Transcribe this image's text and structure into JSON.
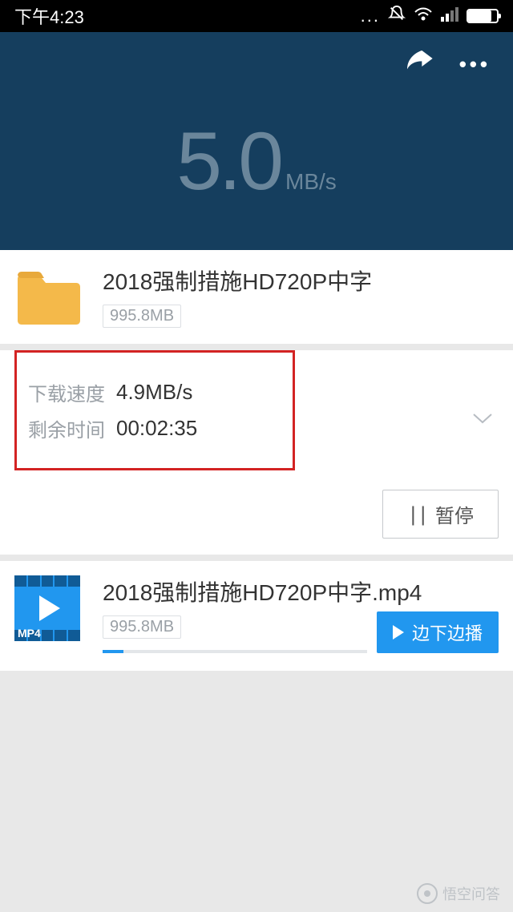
{
  "statusbar": {
    "time": "下午4:23",
    "dots": "...",
    "mute_icon": "bell-off",
    "wifi_icon": "wifi",
    "signal_icon": "signal",
    "battery_icon": "battery"
  },
  "hero": {
    "share_icon": "share",
    "more_icon": "more",
    "speed_value": "5.0",
    "speed_unit": "MB/s"
  },
  "folder": {
    "icon": "folder",
    "title": "2018强制措施HD720P中字",
    "size": "995.8MB"
  },
  "details": {
    "speed_label": "下载速度",
    "speed_value": "4.9MB/s",
    "time_label": "剩余时间",
    "time_value": "00:02:35",
    "chevron_icon": "chevron-down",
    "pause_label": "暂停"
  },
  "file": {
    "icon_type": "MP4",
    "title": "2018强制措施HD720P中字.mp4",
    "size": "995.8MB",
    "play_label": "边下边播"
  },
  "watermark": "悟空问答"
}
